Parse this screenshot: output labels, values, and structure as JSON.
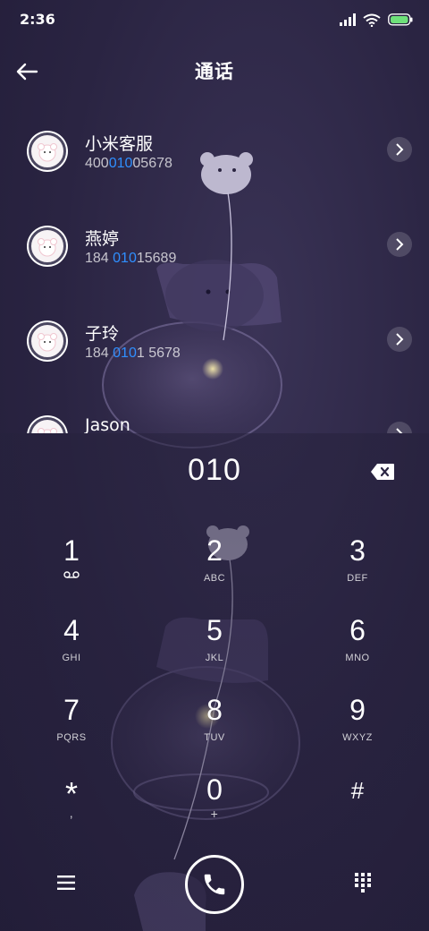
{
  "status_bar": {
    "time": "2:36"
  },
  "header": {
    "title": "通话"
  },
  "contacts": [
    {
      "name": "小米客服",
      "number_pre": "400",
      "number_hl": "010",
      "number_post": "05678"
    },
    {
      "name": "燕婷",
      "number_pre": "184 ",
      "number_hl": "010",
      "number_post": "15689"
    },
    {
      "name": "子玲",
      "number_pre": "184 ",
      "number_hl": "010",
      "number_post": "1 5678"
    },
    {
      "name": "Jason",
      "number_pre": "",
      "number_hl": "",
      "number_post": ""
    }
  ],
  "dialer": {
    "input": "010",
    "keys": [
      {
        "num": "1",
        "sub": ""
      },
      {
        "num": "2",
        "sub": "ABC"
      },
      {
        "num": "3",
        "sub": "DEF"
      },
      {
        "num": "4",
        "sub": "GHI"
      },
      {
        "num": "5",
        "sub": "JKL"
      },
      {
        "num": "6",
        "sub": "MNO"
      },
      {
        "num": "7",
        "sub": "PQRS"
      },
      {
        "num": "8",
        "sub": "TUV"
      },
      {
        "num": "9",
        "sub": "WXYZ"
      },
      {
        "num": "*",
        "sub": ","
      },
      {
        "num": "0",
        "sub": "+"
      },
      {
        "num": "#",
        "sub": ""
      }
    ]
  },
  "colors": {
    "highlight": "#2f8fff",
    "background": "#2c2744"
  },
  "icons": {
    "back": "back-arrow-icon",
    "chevron": "chevron-right-icon",
    "backspace": "backspace-icon",
    "voicemail": "voicemail-icon",
    "menu": "menu-icon",
    "call": "phone-icon",
    "keypad": "keypad-icon"
  }
}
